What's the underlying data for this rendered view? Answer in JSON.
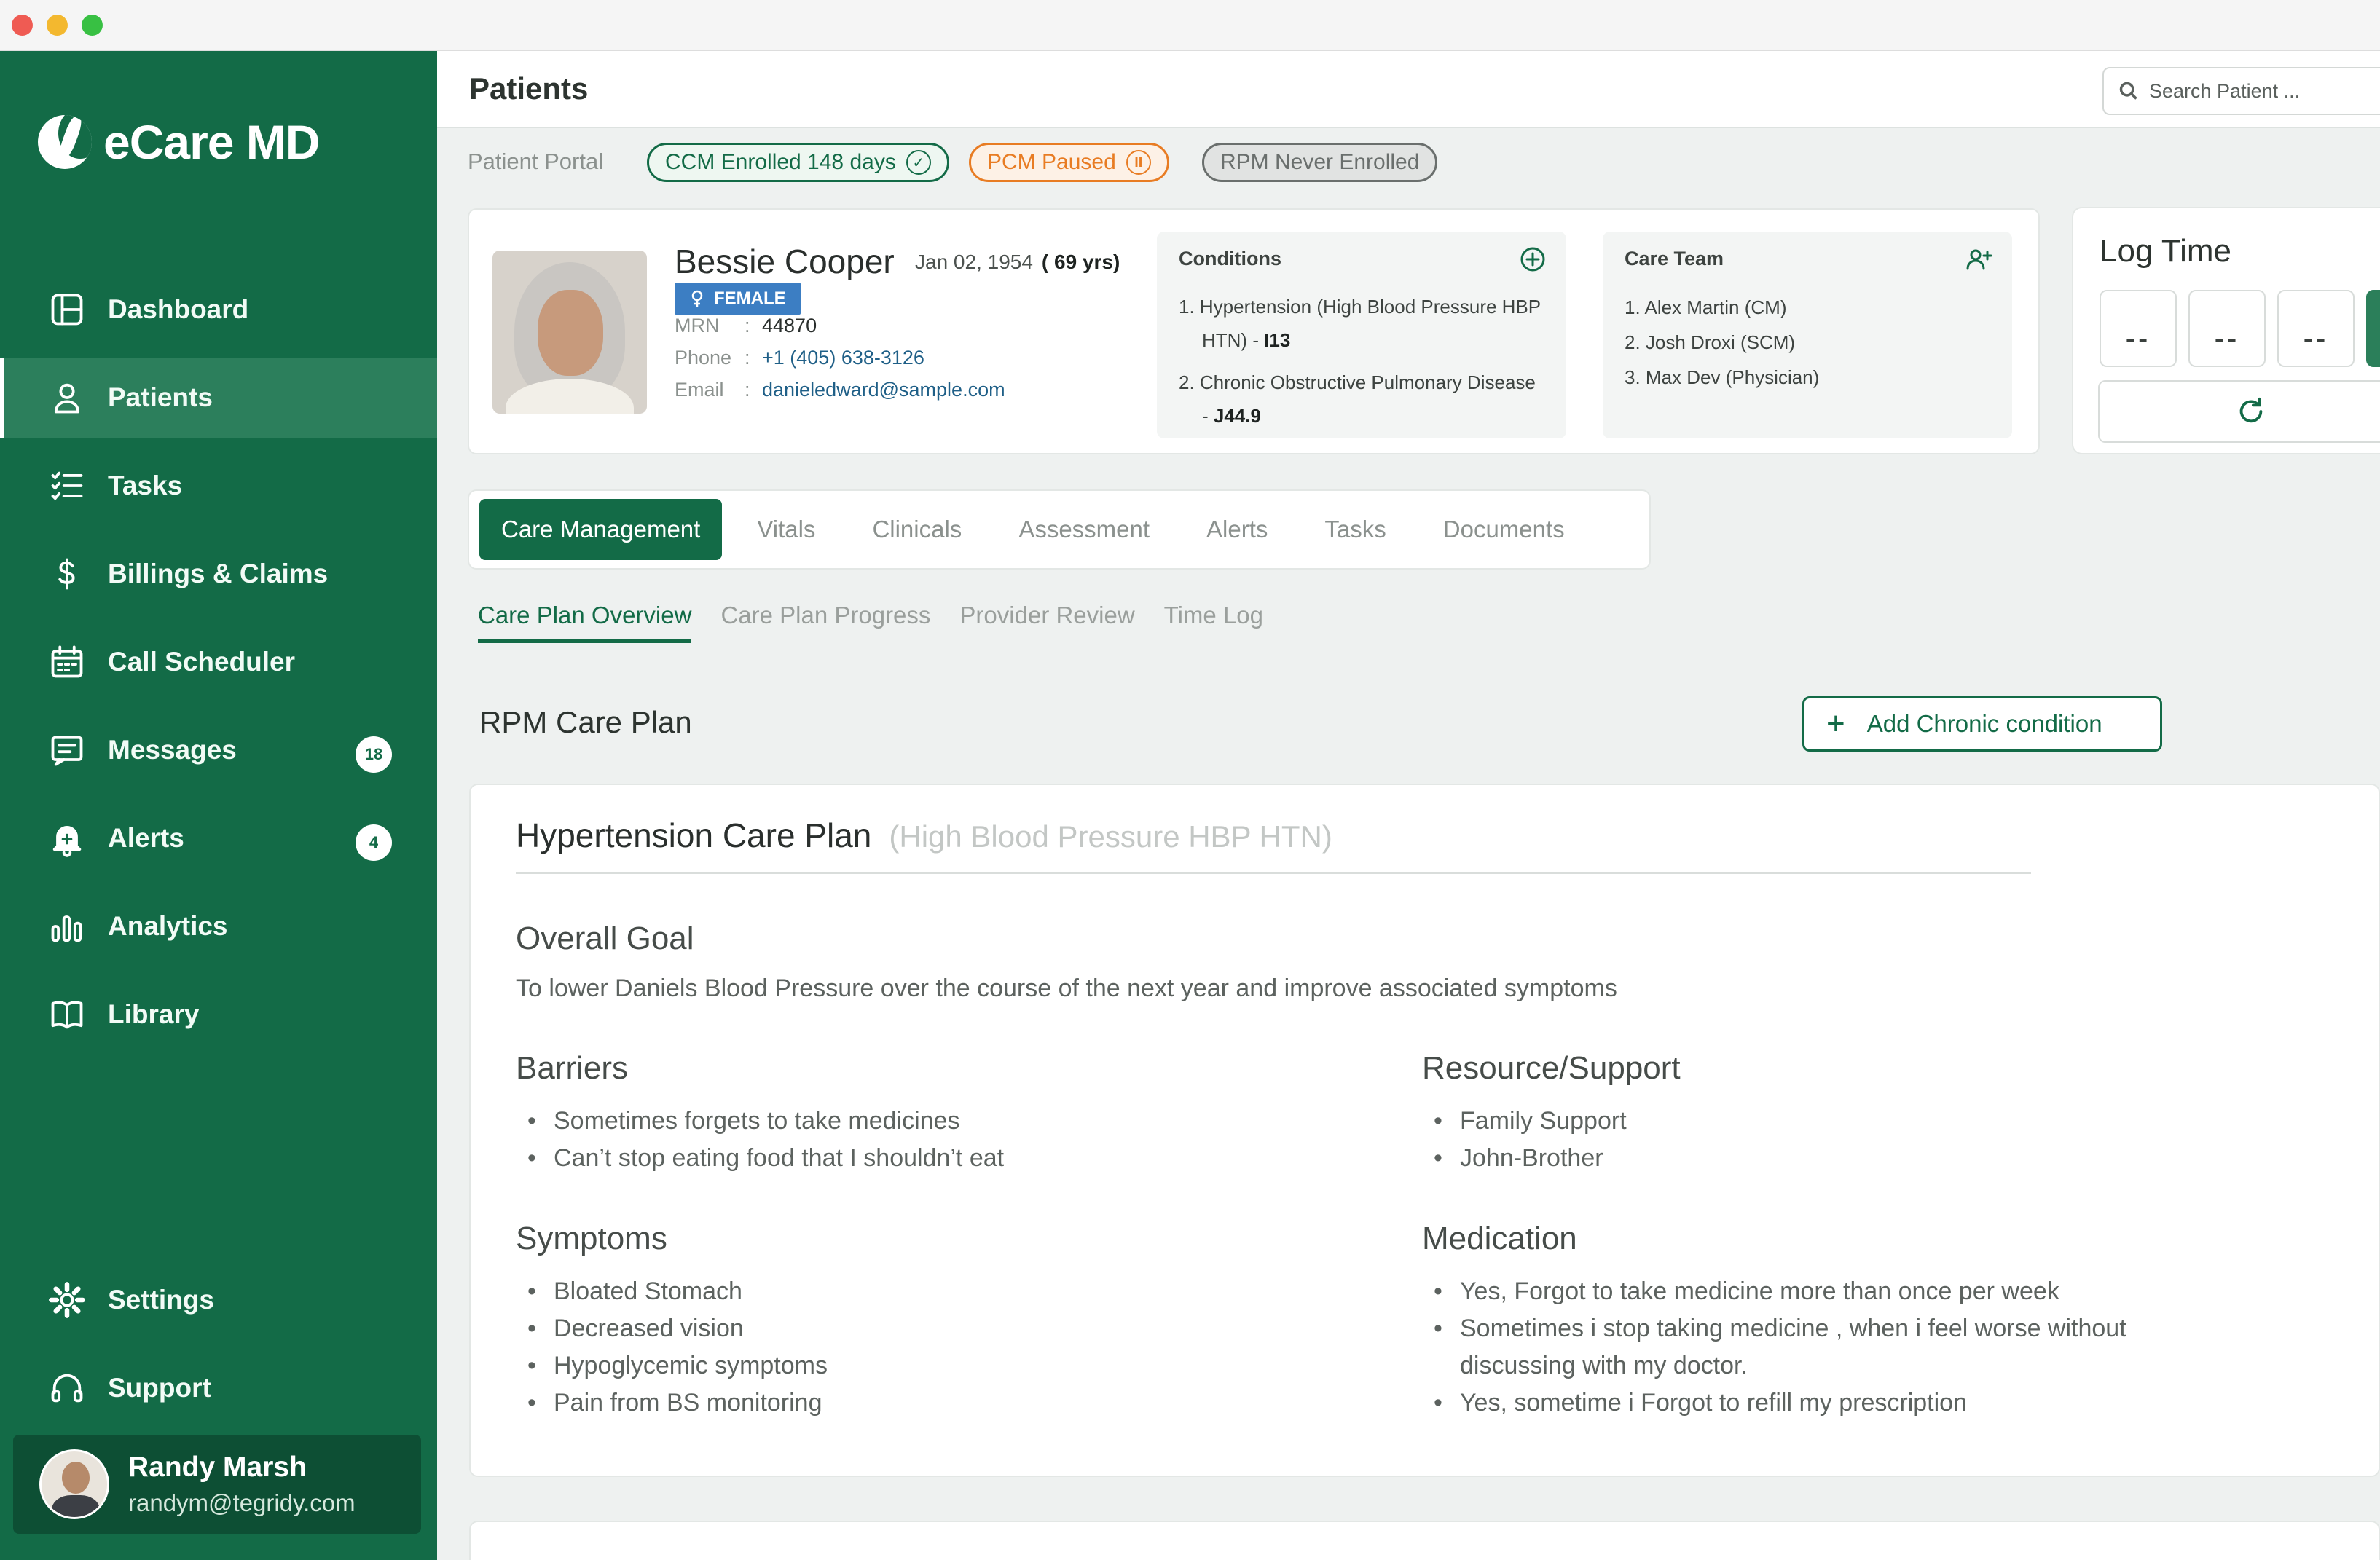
{
  "app": {
    "name": "eCare MD"
  },
  "sidebar": {
    "items": [
      {
        "label": "Dashboard",
        "icon": "dashboard-icon"
      },
      {
        "label": "Patients",
        "icon": "user-icon",
        "active": true
      },
      {
        "label": "Tasks",
        "icon": "checklist-icon"
      },
      {
        "label": "Billings & Claims",
        "icon": "dollar-icon"
      },
      {
        "label": "Call Scheduler",
        "icon": "calendar-icon"
      },
      {
        "label": "Messages",
        "icon": "message-icon",
        "badge": "18"
      },
      {
        "label": "Alerts",
        "icon": "bell-icon",
        "badge": "4"
      },
      {
        "label": "Analytics",
        "icon": "bar-chart-icon"
      },
      {
        "label": "Library",
        "icon": "book-icon"
      }
    ],
    "bottom": [
      {
        "label": "Settings",
        "icon": "gear-icon"
      },
      {
        "label": "Support",
        "icon": "headset-icon"
      }
    ],
    "user": {
      "name": "Randy Marsh",
      "email": "randym@tegridy.com"
    }
  },
  "header": {
    "title": "Patients",
    "search_placeholder": "Search Patient ..."
  },
  "enrollment": {
    "label": "Patient Portal",
    "ccm": "CCM Enrolled 148 days",
    "pcm": "PCM Paused",
    "rpm": "RPM Never Enrolled"
  },
  "patient": {
    "name": "Bessie Cooper",
    "dob": "Jan 02, 1954",
    "age": "( 69 yrs)",
    "gender": "FEMALE",
    "mrn_label": "MRN",
    "mrn": "44870",
    "phone_label": "Phone",
    "phone": "+1 (405) 638-3126",
    "email_label": "Email",
    "email": "danieledward@sample.com"
  },
  "conditions": {
    "title": "Conditions",
    "items": [
      {
        "text": "1. Hypertension (High Blood Pressure HBP HTN) - ",
        "code": "I13"
      },
      {
        "text": "2. Chronic Obstructive Pulmonary Disease - ",
        "code": "J44.9"
      }
    ]
  },
  "care_team": {
    "title": "Care Team",
    "items": [
      "1. Alex Martin (CM)",
      "2. Josh Droxi (SCM)",
      "3. Max Dev (Physician)"
    ]
  },
  "log_time": {
    "title": "Log Time",
    "hours": "--",
    "minutes": "--",
    "seconds": "--"
  },
  "tabs": [
    "Care Management",
    "Vitals",
    "Clinicals",
    "Assessment",
    "Alerts",
    "Tasks",
    "Documents"
  ],
  "subtabs": [
    "Care Plan Overview",
    "Care Plan Progress",
    "Provider Review",
    "Time Log"
  ],
  "care_plan": {
    "section_title": "RPM Care Plan",
    "add_button": "Add Chronic condition",
    "plan_title": "Hypertension Care Plan",
    "plan_subtitle": "(High Blood Pressure HBP HTN)",
    "goal_title": "Overall Goal",
    "goal_text": "To lower Daniels Blood Pressure over the course of the next year and improve associated symptoms",
    "barriers_title": "Barriers",
    "barriers": [
      "Sometimes forgets to take medicines",
      "Can’t stop eating food that I shouldn’t eat"
    ],
    "resources_title": "Resource/Support",
    "resources": [
      "Family Support",
      "John-Brother"
    ],
    "symptoms_title": "Symptoms",
    "symptoms": [
      "Bloated Stomach",
      "Decreased vision",
      "Hypoglycemic symptoms",
      "Pain from BS monitoring"
    ],
    "medication_title": "Medication",
    "medication": [
      "Yes, Forgot to take medicine more than once per week",
      "Sometimes i stop taking medicine , when i feel worse without discussing with my doctor.",
      "Yes, sometime i Forgot to refill my prescription"
    ]
  },
  "colors": {
    "brand": "#136b47",
    "pcm": "#e87c23",
    "gender": "#3c7ec3"
  }
}
